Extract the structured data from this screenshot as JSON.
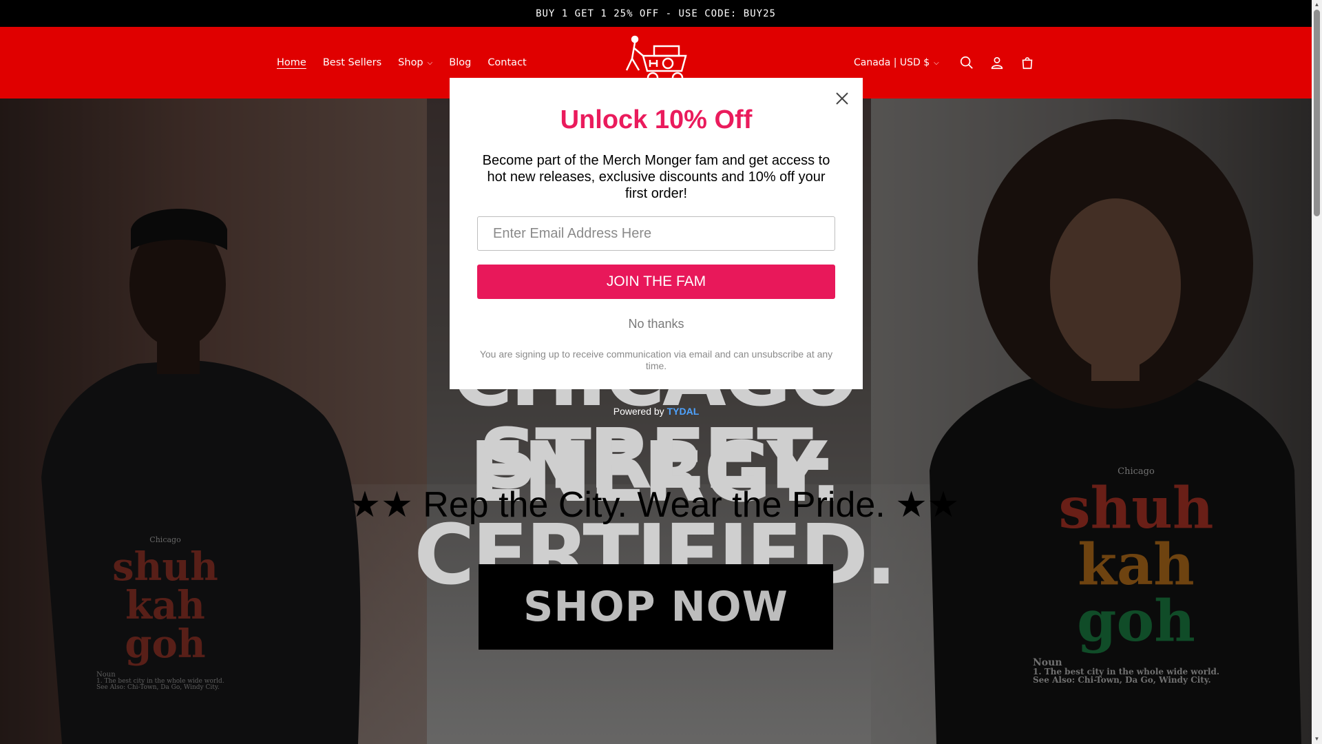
{
  "announcement": {
    "text": "BUY 1 GET 1 25% OFF - USE CODE: BUY25"
  },
  "nav": {
    "items": [
      {
        "label": "Home",
        "active": true
      },
      {
        "label": "Best Sellers"
      },
      {
        "label": "Shop",
        "has_dropdown": true
      },
      {
        "label": "Blog"
      },
      {
        "label": "Contact"
      }
    ]
  },
  "header": {
    "currency": "Canada | USD $",
    "icons": [
      "search-icon",
      "account-icon",
      "cart-icon"
    ],
    "brand_color": "#e00000"
  },
  "hero": {
    "headline_line1": "CHICAGO ENERGY.",
    "headline_line2": "STREET-CERTIFIED.",
    "tagline": "★★ Rep the City. Wear the Pride. ★★",
    "cta": "SHOP NOW",
    "shirt_left": {
      "city": "Chicago",
      "word1": "shuh",
      "word2": "kah",
      "word3": "goh",
      "def": "Noun",
      "line1": "1. The best city in the whole wide world.",
      "line2": "See Also: Chi-Town, Da Go, Windy City."
    },
    "shirt_right": {
      "city": "Chicago",
      "word1": "shuh",
      "word2": "kah",
      "word3": "goh",
      "def": "Noun",
      "line1": "1. The best city in the whole wide world.",
      "line2": "See Also: Chi-Town, Da Go, Windy City."
    }
  },
  "popup": {
    "title": "Unlock 10% Off",
    "body": "Become part of the Merch Monger fam and get access to hot new releases, exclusive discounts and 10% off your first order!",
    "email_placeholder": "Enter Email Address Here",
    "join_label": "JOIN THE FAM",
    "no_thanks": "No thanks",
    "disclaimer": "You are signing up to receive communication via email and can unsubscribe at any time.",
    "powered_prefix": "Powered by",
    "powered_brand": "TYDAL",
    "accent_color": "#e8185a"
  }
}
